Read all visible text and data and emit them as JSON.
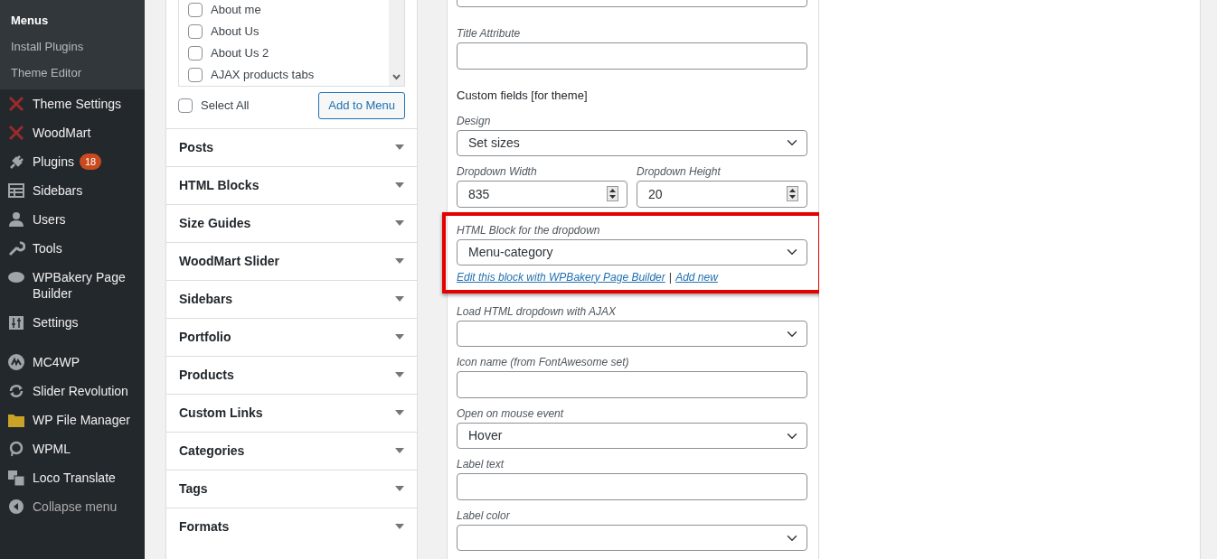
{
  "sidebar": {
    "submenu": [
      {
        "label": "Menus",
        "selected": true
      },
      {
        "label": "Install Plugins",
        "selected": false
      },
      {
        "label": "Theme Editor",
        "selected": false
      }
    ],
    "groups": [
      [
        {
          "label": "Theme Settings"
        },
        {
          "label": "WoodMart"
        },
        {
          "label": "Plugins",
          "badge": "18"
        },
        {
          "label": "Sidebars"
        },
        {
          "label": "Users"
        },
        {
          "label": "Tools"
        },
        {
          "label": "WPBakery Page Builder"
        },
        {
          "label": "Settings"
        }
      ],
      [
        {
          "label": "MC4WP"
        },
        {
          "label": "Slider Revolution"
        },
        {
          "label": "WP File Manager"
        },
        {
          "label": "WPML"
        },
        {
          "label": "Loco Translate"
        }
      ]
    ],
    "collapse": "Collapse menu"
  },
  "pages_box": {
    "items": [
      {
        "label": "About me",
        "checked": false
      },
      {
        "label": "About Us",
        "checked": false
      },
      {
        "label": "About Us 2",
        "checked": false
      },
      {
        "label": "AJAX products tabs",
        "checked": false
      }
    ],
    "select_all": {
      "label": "Select All",
      "checked": false
    },
    "add_button": "Add to Menu"
  },
  "sections": [
    "Posts",
    "HTML Blocks",
    "Size Guides",
    "WoodMart Slider",
    "Sidebars",
    "Portfolio",
    "Products",
    "Custom Links",
    "Categories",
    "Tags",
    "Formats"
  ],
  "item_settings": {
    "fields": [
      {
        "kind": "text"
      },
      {
        "kind": "text",
        "label": "Title Attribute"
      },
      {
        "kind": "heading",
        "label": "Custom fields [for theme]"
      },
      {
        "kind": "select",
        "label": "Design",
        "value": "Set sizes"
      },
      {
        "kind": "pair",
        "items": [
          {
            "label": "Dropdown Width",
            "value": "835"
          },
          {
            "label": "Dropdown Height",
            "value": "20"
          }
        ]
      },
      {
        "kind": "select",
        "label": "HTML Block for the dropdown",
        "value": "Menu-category",
        "highlighted": true,
        "links": [
          "Edit this block with WPBakery Page Builder",
          "Add new"
        ],
        "separator": "|"
      },
      {
        "kind": "select",
        "label": "Load HTML dropdown with AJAX"
      },
      {
        "kind": "text",
        "label": "Icon name (from FontAwesome set)"
      },
      {
        "kind": "select",
        "label": "Open on mouse event",
        "value": "Hover"
      },
      {
        "kind": "text",
        "label": "Label text"
      },
      {
        "kind": "select",
        "label": "Label color"
      }
    ]
  }
}
